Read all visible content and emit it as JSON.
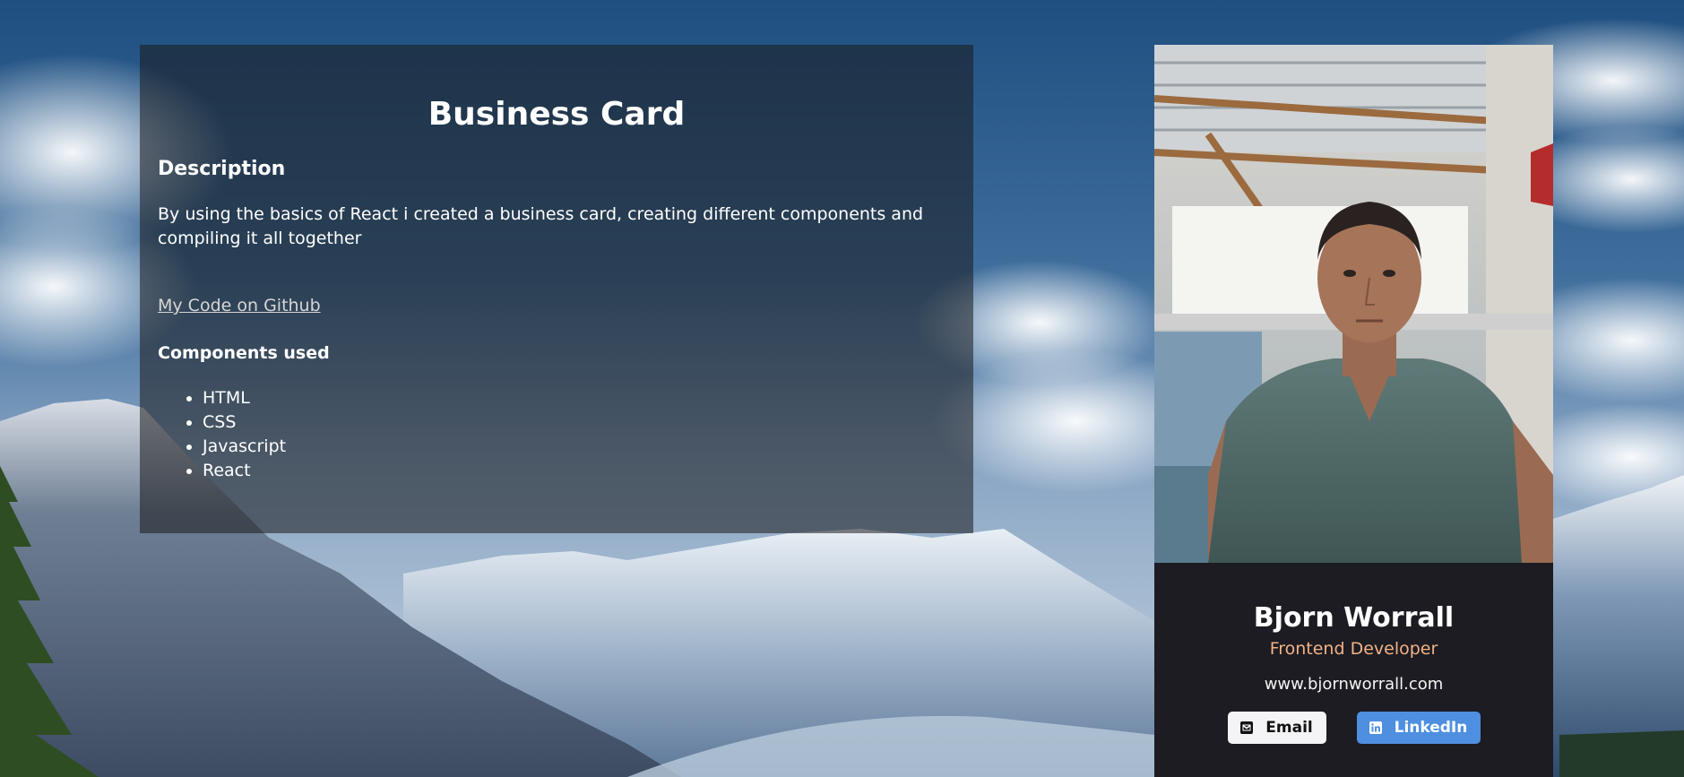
{
  "info": {
    "title": "Business Card",
    "description_heading": "Description",
    "description_text": "By using the basics of React i created a business card, creating different components and compiling it all together",
    "github_link": "My Code on Github",
    "components_heading": "Components used",
    "components": [
      "HTML",
      "CSS",
      "Javascript",
      "React"
    ]
  },
  "card": {
    "name": "Bjorn Worrall",
    "role": "Frontend Developer",
    "website": "www.bjornworrall.com",
    "email_label": "Email",
    "linkedin_label": "LinkedIn",
    "email_icon": "envelope-icon",
    "linkedin_icon": "linkedin-icon"
  },
  "colors": {
    "card_bg": "#1c1c22",
    "role_accent": "#f3b187",
    "linkedin_button": "#4e8fe0",
    "email_button": "#f4f4f6"
  }
}
